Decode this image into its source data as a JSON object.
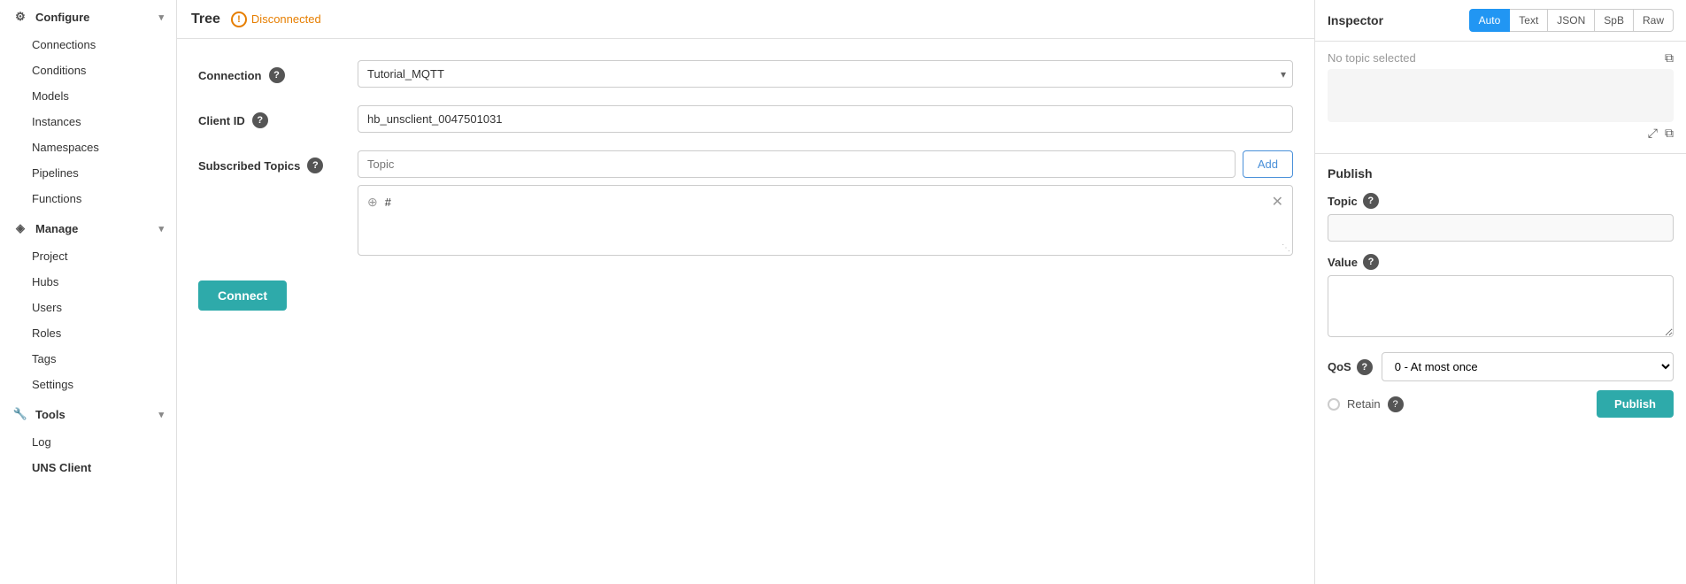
{
  "sidebar": {
    "configure_label": "Configure",
    "manage_label": "Manage",
    "tools_label": "Tools",
    "configure_items": [
      "Connections",
      "Conditions",
      "Models",
      "Instances",
      "Namespaces",
      "Pipelines",
      "Functions"
    ],
    "manage_items": [
      "Project",
      "Hubs",
      "Users",
      "Roles",
      "Tags",
      "Settings"
    ],
    "tools_items": [
      "Log",
      "UNS Client"
    ]
  },
  "header": {
    "tree_label": "Tree",
    "disconnected_label": "Disconnected"
  },
  "form": {
    "connection_label": "Connection",
    "connection_value": "Tutorial_MQTT",
    "client_id_label": "Client ID",
    "client_id_value": "hb_unsclient_0047501031",
    "subscribed_topics_label": "Subscribed Topics",
    "topic_placeholder": "Topic",
    "add_label": "Add",
    "topic_tag": "#",
    "connect_label": "Connect"
  },
  "inspector": {
    "title": "Inspector",
    "tabs": [
      "Auto",
      "Text",
      "JSON",
      "SpB",
      "Raw"
    ],
    "active_tab": "Auto",
    "no_topic_label": "No topic selected"
  },
  "publish": {
    "title": "Publish",
    "topic_label": "Topic",
    "value_label": "Value",
    "qos_label": "QoS",
    "qos_value": "0 - At most once",
    "retain_label": "Retain",
    "publish_label": "Publish"
  }
}
